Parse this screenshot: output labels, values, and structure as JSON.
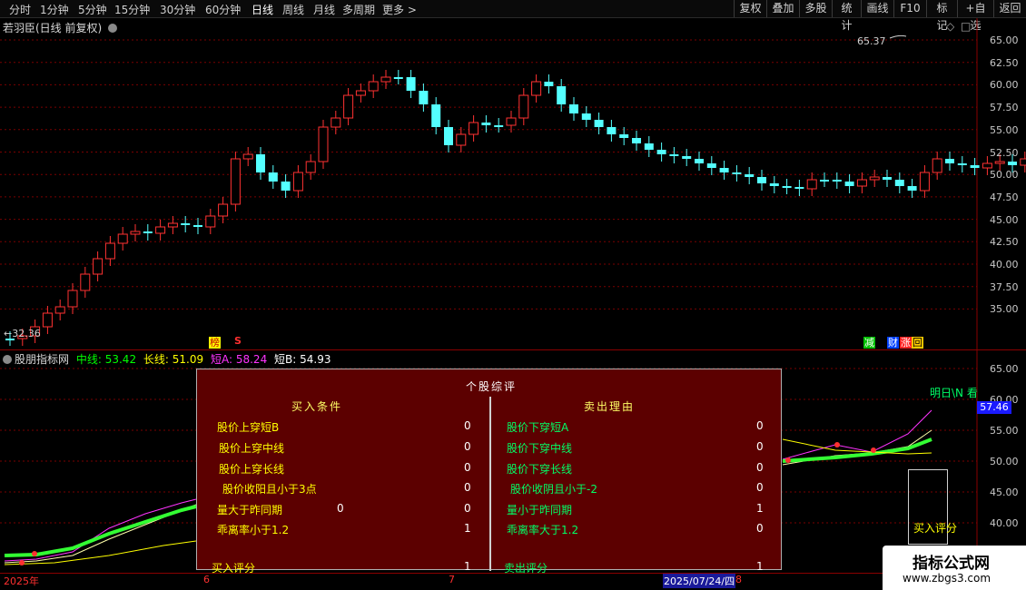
{
  "toolbar": {
    "periods": [
      "分时",
      "1分钟",
      "5分钟",
      "15分钟",
      "30分钟",
      "60分钟",
      "日线",
      "周线",
      "月线",
      "多周期",
      "更多"
    ],
    "active_period": "日线",
    "more_arrow": ">",
    "right_buttons": [
      "复权",
      "叠加",
      "多股",
      "统计",
      "画线",
      "F10",
      "+自选",
      "返回"
    ]
  },
  "main_chart": {
    "title": "若羽臣(日线 前复权)",
    "high_label": "65.37",
    "low_label": "32.36",
    "price_axis": [
      "65.00",
      "62.50",
      "60.00",
      "57.50",
      "55.00",
      "52.50",
      "50.00",
      "47.50",
      "45.00",
      "42.50",
      "40.00",
      "37.50",
      "35.00"
    ],
    "badges": {
      "bang": "榜",
      "s": "S",
      "jian": "减",
      "cai": "财",
      "zhang": "涨",
      "hui": "回"
    },
    "top_icons": {
      "diamond": "◇",
      "square": "□"
    }
  },
  "indicator": {
    "name": "股朋指标网",
    "zhongxian_label": "中线:",
    "zhongxian_value": "53.42",
    "changxian_label": "长线:",
    "changxian_value": "51.09",
    "duanA_label": "短A:",
    "duanA_value": "58.24",
    "duanB_label": "短B:",
    "duanB_value": "54.93",
    "axis": [
      "65.00",
      "60.00",
      "55.00",
      "50.00",
      "45.00",
      "40.00"
    ],
    "current_value": "57.46",
    "right_text": "明日\\N 看",
    "buy_score_box": "买入评分"
  },
  "time_axis": {
    "year": "2025年",
    "m6": "6",
    "m7": "7",
    "cursor_date": "2025/07/24/四",
    "m8": "8"
  },
  "review": {
    "title": "个股综评",
    "buy_header": "买入条件",
    "sell_header": "卖出理由",
    "buy_rows": [
      {
        "label": "股价上穿短B",
        "value": "0"
      },
      {
        "label": "股价上穿中线",
        "value": "0"
      },
      {
        "label": "股价上穿长线",
        "value": "0"
      },
      {
        "label": "股价收阳且小于3点",
        "value": "0"
      },
      {
        "label": "量大于昨同期",
        "value": "0",
        "extra": "0"
      },
      {
        "label": "乖离率小于1.2",
        "value": "1"
      }
    ],
    "sell_rows": [
      {
        "label": "股价下穿短A",
        "value": "0"
      },
      {
        "label": "股价下穿中线",
        "value": "0"
      },
      {
        "label": "股价下穿长线",
        "value": "0"
      },
      {
        "label": "股价收阴且小于-2",
        "value": "0"
      },
      {
        "label": "量小于昨同期",
        "value": "1"
      },
      {
        "label": "乖离率大于1.2",
        "value": "0"
      }
    ],
    "buy_score_label": "买入评分",
    "buy_score_value": "1",
    "sell_score_label": "卖出评分",
    "sell_score_value": "1"
  },
  "watermark": {
    "line1": "指标公式网",
    "line2": "www.zbgs3.com"
  },
  "colors": {
    "up": "#ff3232",
    "down": "#54ffff",
    "grid": "#7a0000",
    "popup": "#5c0000",
    "zhongxian": "#00ff00",
    "changxian": "#ffff00",
    "duanA": "#ff00ff",
    "duanB": "#ffffff"
  }
}
